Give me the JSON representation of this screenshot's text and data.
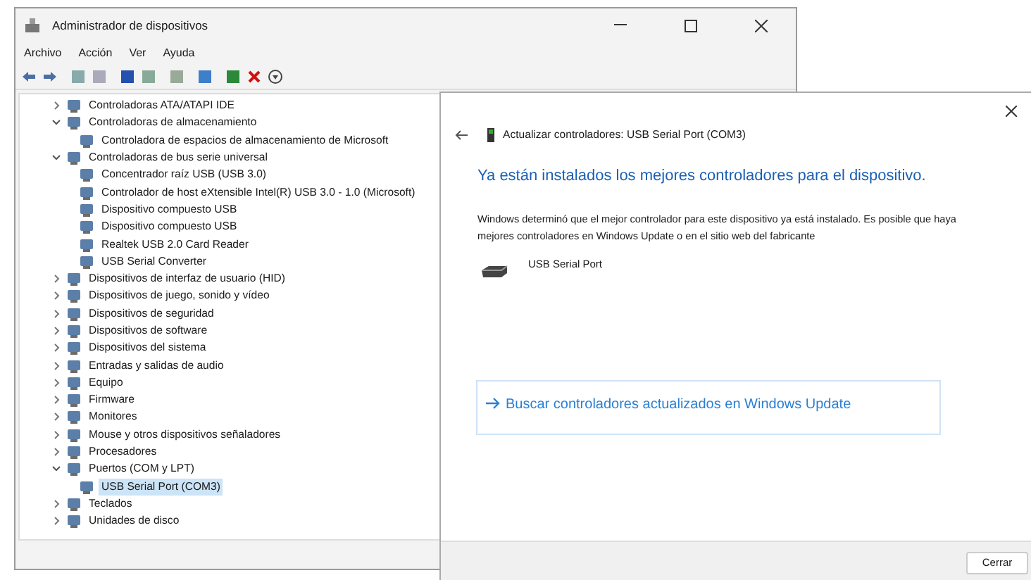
{
  "window": {
    "title": "Administrador de dispositivos"
  },
  "menu": [
    "Archivo",
    "Acción",
    "Ver",
    "Ayuda"
  ],
  "tree": [
    {
      "label": "Controladoras ATA/ATAPI IDE",
      "expanded": false,
      "selected": false
    },
    {
      "label": "Controladoras de almacenamiento",
      "expanded": true,
      "selected": false,
      "children": [
        {
          "label": "Controladora de espacios de almacenamiento de Microsoft",
          "selected": false
        }
      ]
    },
    {
      "label": "Controladoras de bus serie universal",
      "expanded": true,
      "selected": false,
      "children": [
        {
          "label": "Concentrador raíz USB (USB 3.0)",
          "selected": false
        },
        {
          "label": "Controlador de host eXtensible Intel(R) USB 3.0 - 1.0 (Microsoft)",
          "selected": false
        },
        {
          "label": "Dispositivo compuesto USB",
          "selected": false
        },
        {
          "label": "Dispositivo compuesto USB",
          "selected": false
        },
        {
          "label": "Realtek USB 2.0 Card Reader",
          "selected": false
        },
        {
          "label": "USB Serial Converter",
          "selected": false
        }
      ]
    },
    {
      "label": "Dispositivos de interfaz de usuario (HID)",
      "expanded": false,
      "selected": false
    },
    {
      "label": "Dispositivos de juego, sonido y vídeo",
      "expanded": false,
      "selected": false
    },
    {
      "label": "Dispositivos de seguridad",
      "expanded": false,
      "selected": false
    },
    {
      "label": "Dispositivos de software",
      "expanded": false,
      "selected": false
    },
    {
      "label": "Dispositivos del sistema",
      "expanded": false,
      "selected": false
    },
    {
      "label": "Entradas y salidas de audio",
      "expanded": false,
      "selected": false
    },
    {
      "label": "Equipo",
      "expanded": false,
      "selected": false
    },
    {
      "label": "Firmware",
      "expanded": false,
      "selected": false
    },
    {
      "label": "Monitores",
      "expanded": false,
      "selected": false
    },
    {
      "label": "Mouse y otros dispositivos señaladores",
      "expanded": false,
      "selected": false
    },
    {
      "label": "Procesadores",
      "expanded": false,
      "selected": false
    },
    {
      "label": "Puertos (COM y LPT)",
      "expanded": true,
      "selected": false,
      "children": [
        {
          "label": "USB Serial Port (COM3)",
          "selected": true
        }
      ]
    },
    {
      "label": "Teclados",
      "expanded": false,
      "selected": false
    },
    {
      "label": "Unidades de disco",
      "expanded": false,
      "selected": false
    }
  ],
  "dialog": {
    "title": "Actualizar controladores: USB Serial Port (COM3)",
    "heading": "Ya están instalados los mejores controladores para el dispositivo.",
    "message": "Windows determinó que el mejor controlador para este dispositivo ya está instalado. Es posible que haya mejores controladores en Windows Update o en el sitio web del fabricante",
    "device": "USB Serial Port",
    "link": "Buscar controladores actualizados en Windows Update",
    "close_button": "Cerrar"
  }
}
